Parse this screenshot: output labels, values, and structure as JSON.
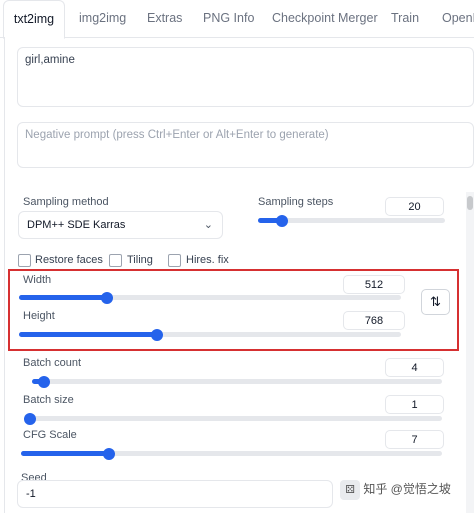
{
  "tabs": [
    {
      "label": "txt2img",
      "active": true
    },
    {
      "label": "img2img"
    },
    {
      "label": "Extras"
    },
    {
      "label": "PNG Info"
    },
    {
      "label": "Checkpoint Merger"
    },
    {
      "label": "Train"
    },
    {
      "label": "OpenP"
    }
  ],
  "prompt": {
    "value": "girl,amine"
  },
  "negative_prompt": {
    "placeholder": "Negative prompt (press Ctrl+Enter or Alt+Enter to generate)"
  },
  "sampling_method": {
    "label": "Sampling method",
    "value": "DPM++ SDE Karras",
    "icon": "chevron-down-icon"
  },
  "sampling_steps": {
    "label": "Sampling steps",
    "value": "20",
    "fraction": 0.13
  },
  "checkboxes": {
    "restore_faces": {
      "label": "Restore faces",
      "checked": false
    },
    "tiling": {
      "label": "Tiling",
      "checked": false
    },
    "hires_fix": {
      "label": "Hires. fix",
      "checked": false
    }
  },
  "width": {
    "label": "Width",
    "value": "512",
    "fraction": 0.23
  },
  "height": {
    "label": "Height",
    "value": "768",
    "fraction": 0.36
  },
  "swap_button": {
    "icon": "swap-vertical-icon",
    "glyph": "⇅"
  },
  "batch_count": {
    "label": "Batch count",
    "value": "4",
    "fraction": 0.03
  },
  "batch_size": {
    "label": "Batch size",
    "value": "1",
    "fraction": 0.0
  },
  "cfg_scale": {
    "label": "CFG Scale",
    "value": "7",
    "fraction": 0.21
  },
  "seed": {
    "label": "Seed",
    "value": "-1"
  },
  "watermark": {
    "text": "知乎 @觉悟之坡",
    "icons": [
      "dice-icon",
      "recycle-icon"
    ]
  },
  "colors": {
    "accent": "#2563eb",
    "highlight_box": "#d63031",
    "track": "#e5e7eb"
  }
}
